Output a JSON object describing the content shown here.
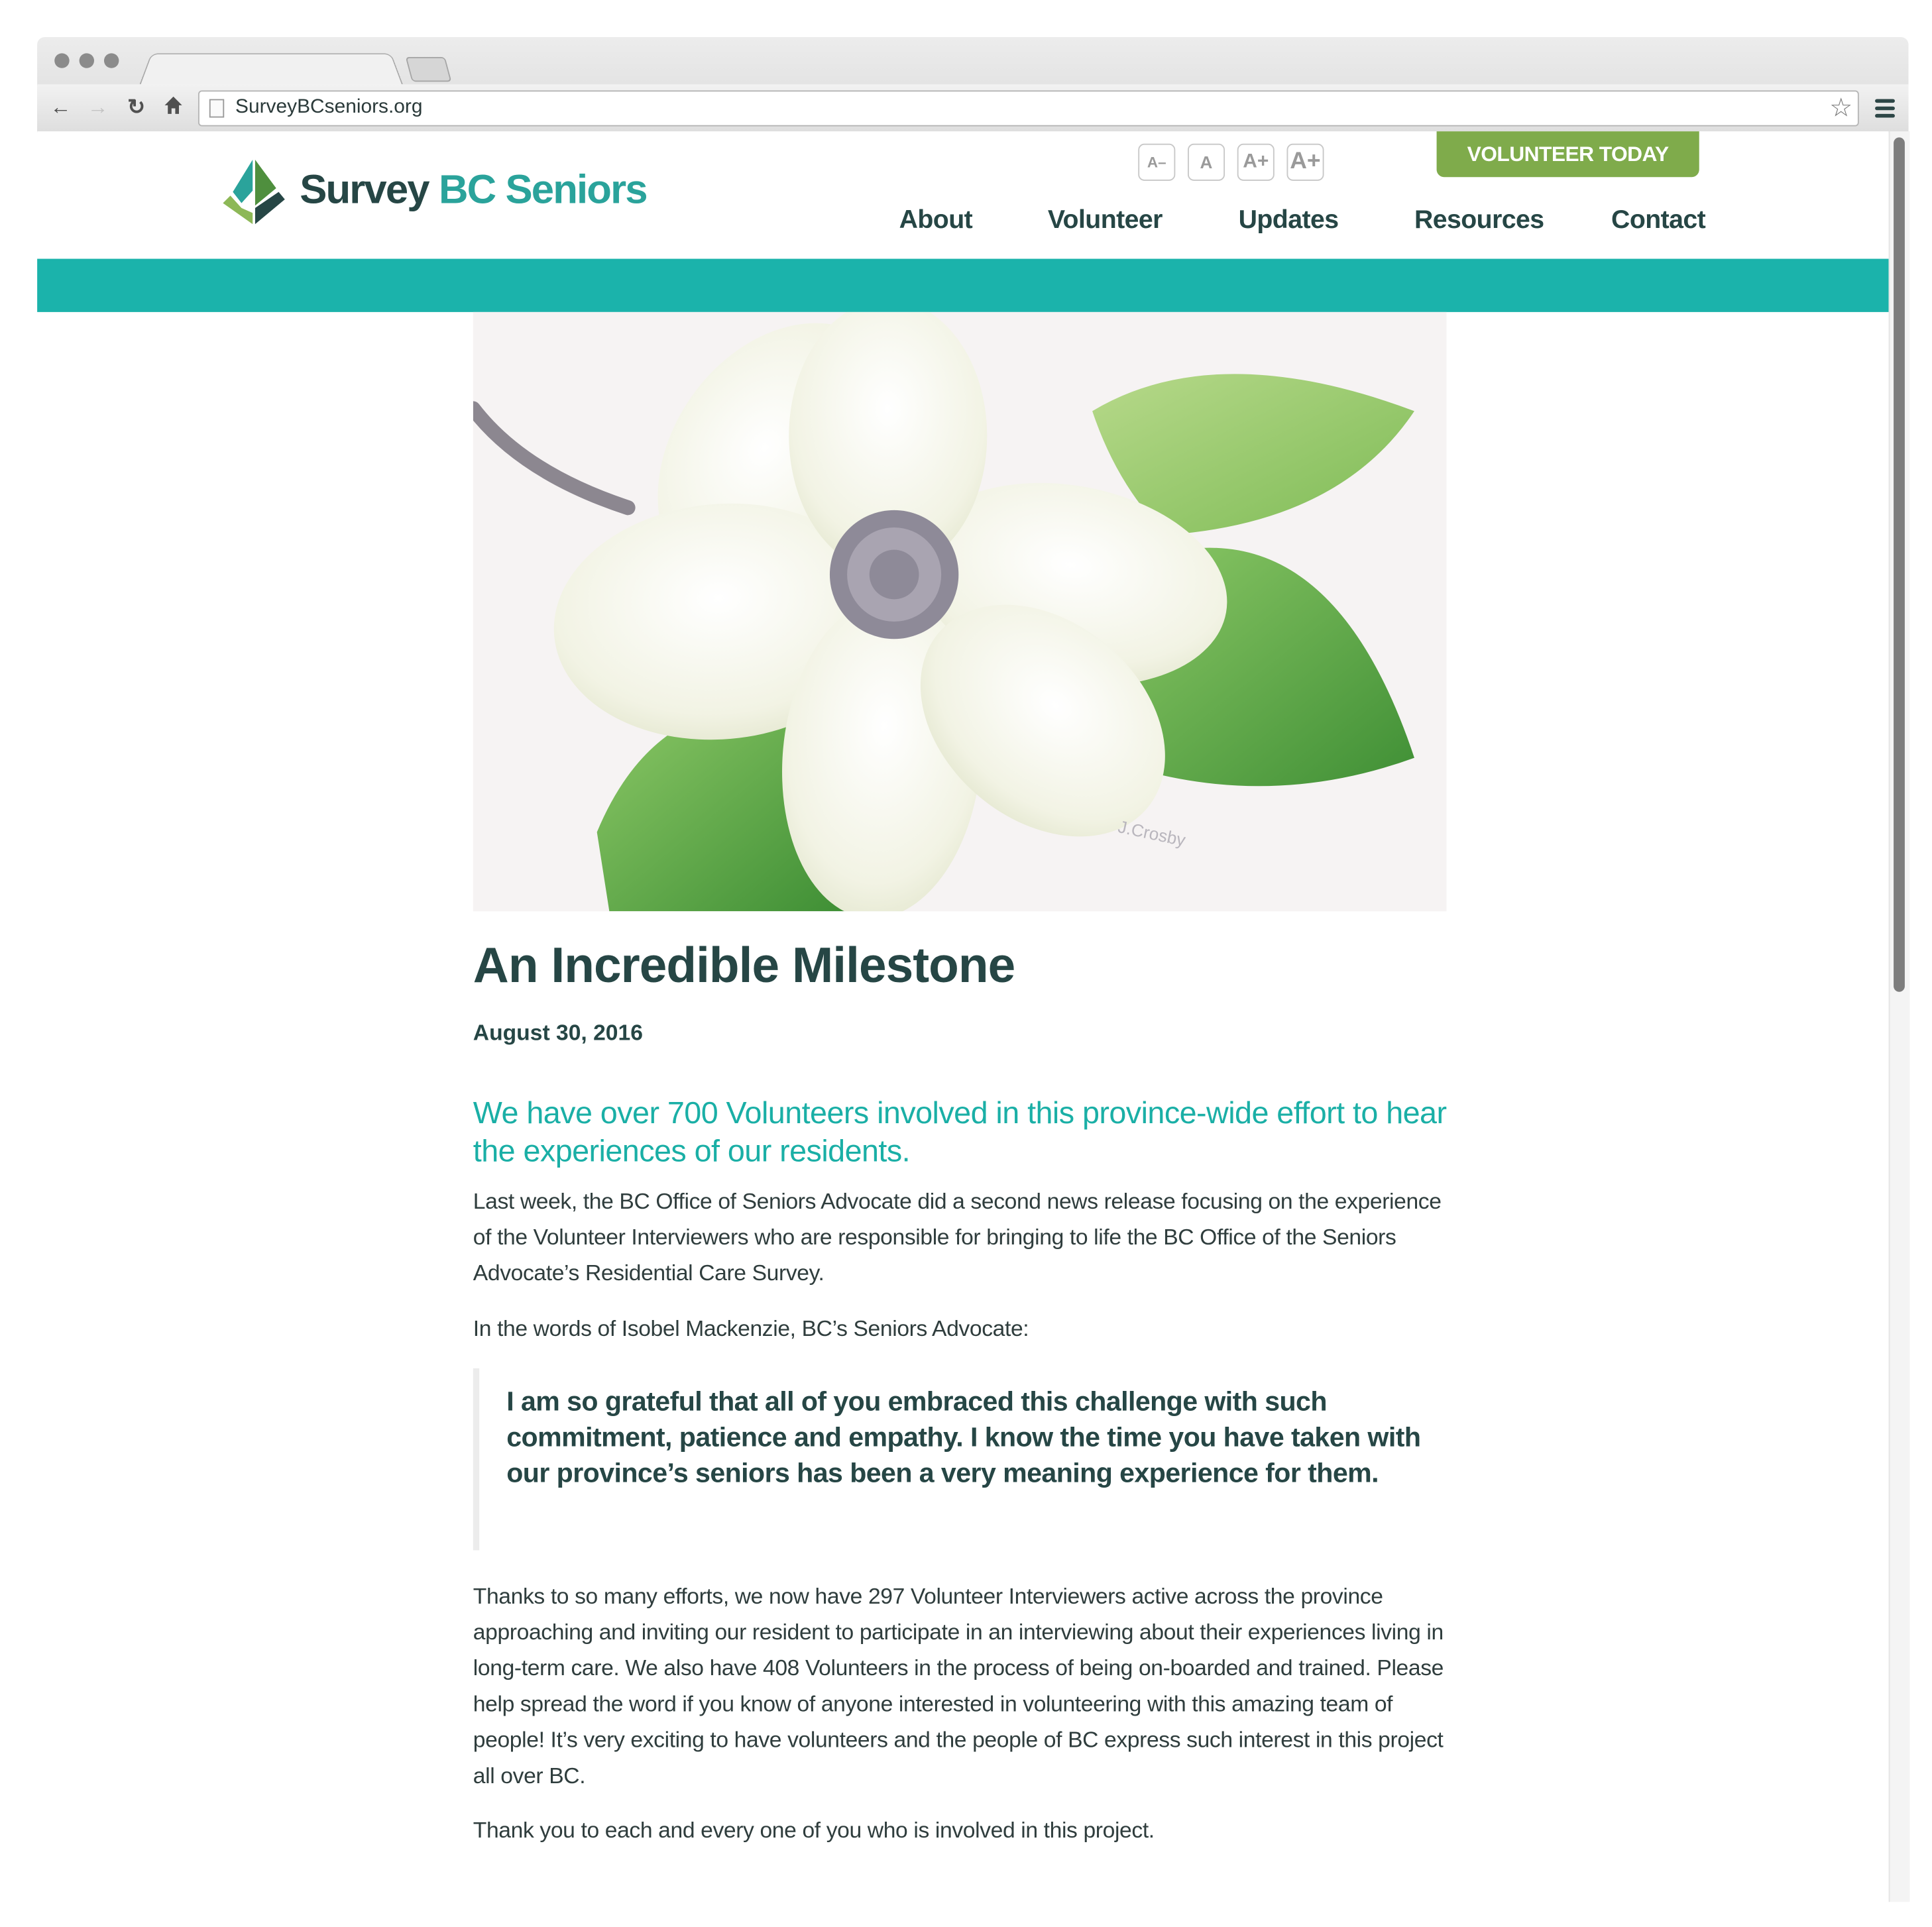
{
  "browser": {
    "url": "SurveyBCseniors.org",
    "back_icon": "back-arrow-icon",
    "forward_icon": "forward-arrow-icon",
    "reload_icon": "reload-icon",
    "home_icon": "home-icon",
    "bookmark_icon": "star-icon",
    "menu_icon": "hamburger-menu-icon"
  },
  "site": {
    "logo_word1": "Survey",
    "logo_word2": "BC Seniors",
    "font_size_controls": [
      "A–",
      "A",
      "A+",
      "A+"
    ],
    "cta_label": "VOLUNTEER TODAY",
    "nav": [
      "About",
      "Volunteer",
      "Updates",
      "Resources",
      "Contact"
    ],
    "colors": {
      "brand_dark": "#264645",
      "brand_teal": "#1bb3ab",
      "cta_green": "#7fab4b"
    }
  },
  "article": {
    "hero_alt": "Watercolor painting of a white dogwood flower with green leaves",
    "hero_signature": "J.Crosby",
    "title": "An Incredible Milestone",
    "date": "August 30, 2016",
    "lead": "We have over 700 Volunteers involved in this province-wide effort to hear the experiences of our residents.",
    "p1": "Last week, the BC Office of Seniors Advocate did a second news release focusing on the experience of the Volunteer Interviewers who are responsible for bringing to life the BC Office of the Seniors Advocate’s Residential Care Survey.",
    "p2": "In the words of Isobel Mackenzie, BC’s Seniors Advocate:",
    "quote": "I am so grateful that all of you embraced this challenge with such commitment, patience and empathy. I know the time you have taken with our province’s seniors has been a very meaning experience for them.",
    "p3": "Thanks to so many efforts, we now have 297 Volunteer Interviewers active across the province approaching and inviting our resident to participate in an interviewing about their experiences living in long-term care. We also have 408 Volunteers in the process of being on-boarded and trained. Please help spread the word if you know of anyone interested in volunteering with this amazing team of people! It’s very exciting to have volunteers and the people of BC express such interest in this project all over BC.",
    "p4": "Thank you to each and every one of you who is involved in this project."
  }
}
